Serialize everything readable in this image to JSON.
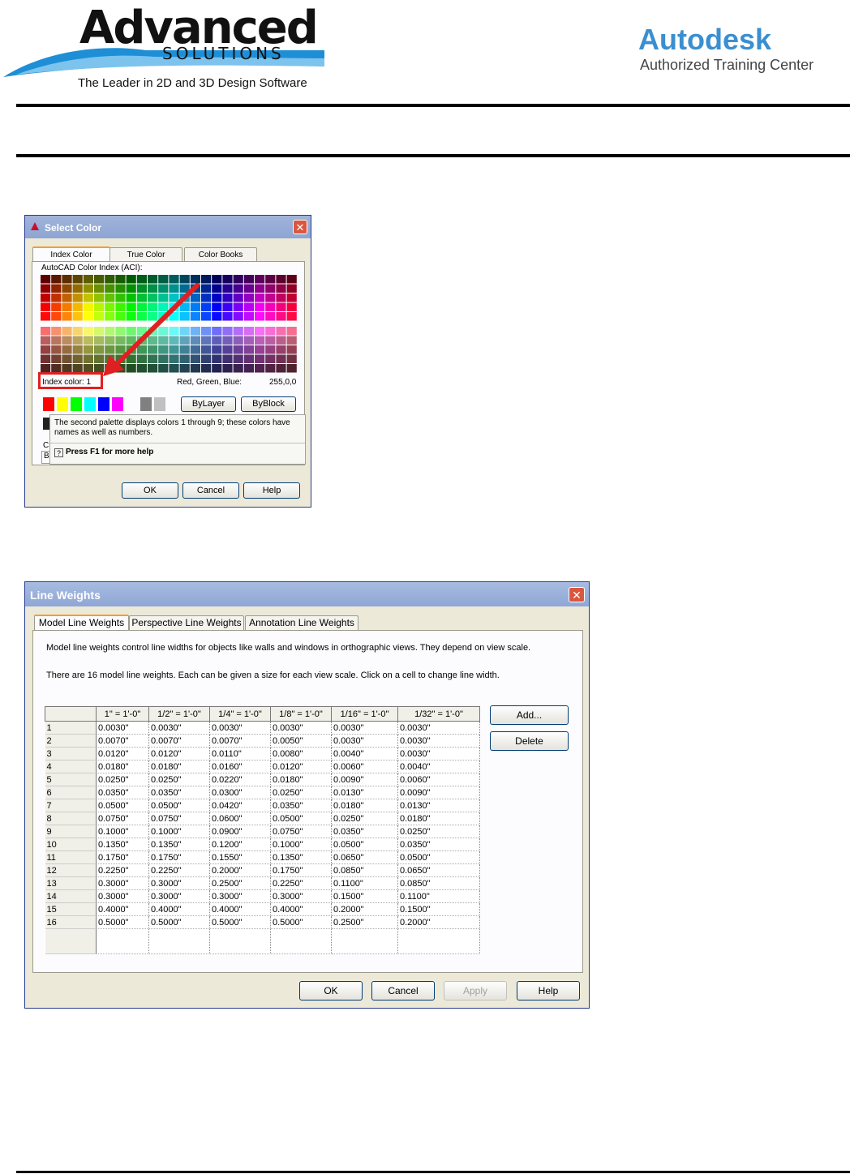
{
  "header": {
    "brand_name": "Advanced",
    "brand_sub": "SOLUTIONS",
    "brand_tagline": "The Leader in 2D and 3D Design Software",
    "partner_name": "Autodesk",
    "partner_sub": "Authorized Training Center"
  },
  "select_color": {
    "title": "Select Color",
    "tabs": [
      "Index Color",
      "True Color",
      "Color Books"
    ],
    "aci_label": "AutoCAD Color Index (ACI):",
    "index_color_label": "Index color:  1",
    "rgb_label": "Red, Green, Blue:",
    "rgb_value": "255,0,0",
    "bylayer": "ByLayer",
    "byblock": "ByBlock",
    "tooltip_text": "The second palette displays colors 1 through 9; these colors have names as well as numbers.",
    "tooltip_help": "Press F1 for more help",
    "ok": "OK",
    "cancel": "Cancel",
    "help": "Help",
    "color_field_initial": "B",
    "color_label_initial": "C"
  },
  "line_weights": {
    "title": "Line Weights",
    "tabs": [
      "Model Line Weights",
      "Perspective Line Weights",
      "Annotation Line Weights"
    ],
    "desc1": "Model line weights control line widths for objects like walls and windows in orthographic views. They depend on view scale.",
    "desc2": "There are 16 model line weights. Each can be given a size for each view scale. Click on a cell to change line width.",
    "columns": [
      "1\" = 1'-0\"",
      "1/2\" = 1'-0\"",
      "1/4\" = 1'-0\"",
      "1/8\" = 1'-0\"",
      "1/16\" = 1'-0\"",
      "1/32\" = 1'-0\""
    ],
    "rows": [
      [
        "1",
        "0.0030\"",
        "0.0030\"",
        "0.0030\"",
        "0.0030\"",
        "0.0030\"",
        "0.0030\""
      ],
      [
        "2",
        "0.0070\"",
        "0.0070\"",
        "0.0070\"",
        "0.0050\"",
        "0.0030\"",
        "0.0030\""
      ],
      [
        "3",
        "0.0120\"",
        "0.0120\"",
        "0.0110\"",
        "0.0080\"",
        "0.0040\"",
        "0.0030\""
      ],
      [
        "4",
        "0.0180\"",
        "0.0180\"",
        "0.0160\"",
        "0.0120\"",
        "0.0060\"",
        "0.0040\""
      ],
      [
        "5",
        "0.0250\"",
        "0.0250\"",
        "0.0220\"",
        "0.0180\"",
        "0.0090\"",
        "0.0060\""
      ],
      [
        "6",
        "0.0350\"",
        "0.0350\"",
        "0.0300\"",
        "0.0250\"",
        "0.0130\"",
        "0.0090\""
      ],
      [
        "7",
        "0.0500\"",
        "0.0500\"",
        "0.0420\"",
        "0.0350\"",
        "0.0180\"",
        "0.0130\""
      ],
      [
        "8",
        "0.0750\"",
        "0.0750\"",
        "0.0600\"",
        "0.0500\"",
        "0.0250\"",
        "0.0180\""
      ],
      [
        "9",
        "0.1000\"",
        "0.1000\"",
        "0.0900\"",
        "0.0750\"",
        "0.0350\"",
        "0.0250\""
      ],
      [
        "10",
        "0.1350\"",
        "0.1350\"",
        "0.1200\"",
        "0.1000\"",
        "0.0500\"",
        "0.0350\""
      ],
      [
        "11",
        "0.1750\"",
        "0.1750\"",
        "0.1550\"",
        "0.1350\"",
        "0.0650\"",
        "0.0500\""
      ],
      [
        "12",
        "0.2250\"",
        "0.2250\"",
        "0.2000\"",
        "0.1750\"",
        "0.0850\"",
        "0.0650\""
      ],
      [
        "13",
        "0.3000\"",
        "0.3000\"",
        "0.2500\"",
        "0.2250\"",
        "0.1100\"",
        "0.0850\""
      ],
      [
        "14",
        "0.3000\"",
        "0.3000\"",
        "0.3000\"",
        "0.3000\"",
        "0.1500\"",
        "0.1100\""
      ],
      [
        "15",
        "0.4000\"",
        "0.4000\"",
        "0.4000\"",
        "0.4000\"",
        "0.2000\"",
        "0.1500\""
      ],
      [
        "16",
        "0.5000\"",
        "0.5000\"",
        "0.5000\"",
        "0.5000\"",
        "0.2500\"",
        "0.2000\""
      ]
    ],
    "add": "Add...",
    "delete": "Delete",
    "ok": "OK",
    "cancel": "Cancel",
    "apply": "Apply",
    "help": "Help"
  },
  "colors": {
    "highlight_red": "#e02020",
    "xp_title_blue": "#8ea5d3",
    "brand_blue": "#3a8fd0"
  }
}
